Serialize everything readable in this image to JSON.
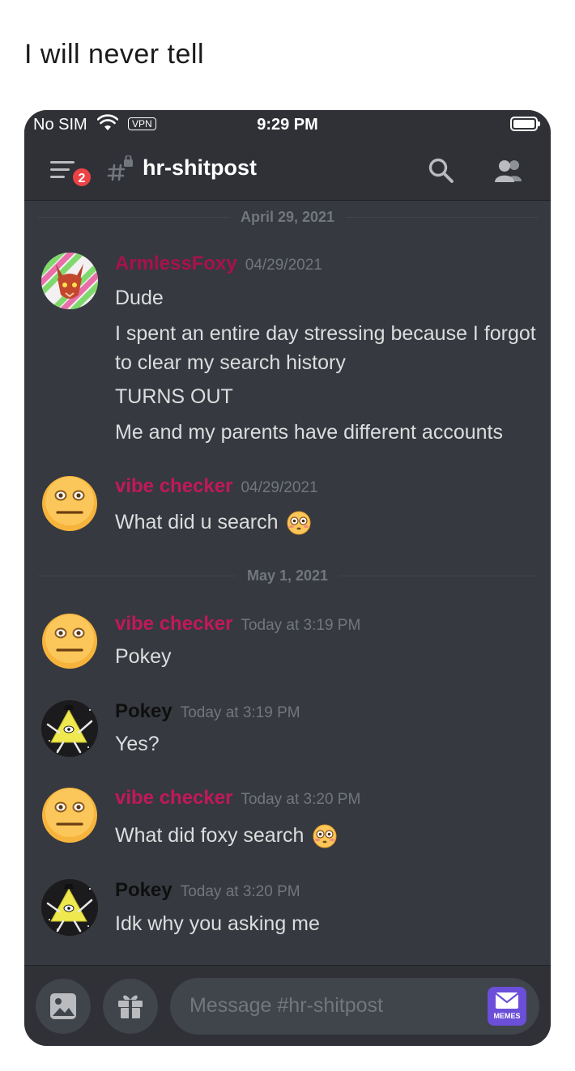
{
  "caption": "I will never tell",
  "status_bar": {
    "carrier": "No SIM",
    "vpn": "VPN",
    "time": "9:29 PM"
  },
  "header": {
    "notification_count": "2",
    "channel_name": "hr-shitpost"
  },
  "date_dividers": [
    "April 29, 2021",
    "May 1, 2021"
  ],
  "messages": [
    {
      "author": "ArmlessFoxy",
      "author_color": "#a8124a",
      "timestamp": "04/29/2021",
      "lines": [
        "Dude",
        "I spent an entire day stressing because I forgot to clear my search history",
        "TURNS OUT",
        "Me and my parents have different accounts"
      ],
      "avatar": "fox-avatar"
    },
    {
      "author": "vibe checker",
      "author_color": "#c2185b",
      "timestamp": "04/29/2021",
      "lines": [
        "What did u search"
      ],
      "emoji": "flushed-face",
      "avatar": "emoji-face-avatar"
    },
    {
      "author": "vibe checker",
      "author_color": "#c2185b",
      "timestamp": "Today at 3:19 PM",
      "lines": [
        "Pokey"
      ],
      "avatar": "emoji-face-avatar"
    },
    {
      "author": "Pokey",
      "author_color": "#0f0f0f",
      "timestamp": "Today at 3:19 PM",
      "lines": [
        "Yes?"
      ],
      "avatar": "triangle-avatar"
    },
    {
      "author": "vibe checker",
      "author_color": "#c2185b",
      "timestamp": "Today at 3:20 PM",
      "lines": [
        "What did foxy search"
      ],
      "emoji": "flushed-face",
      "avatar": "emoji-face-avatar"
    },
    {
      "author": "Pokey",
      "author_color": "#0f0f0f",
      "timestamp": "Today at 3:20 PM",
      "lines": [
        "Idk why you asking me"
      ],
      "avatar": "triangle-avatar"
    }
  ],
  "composer": {
    "placeholder": "Message #hr-shitpost",
    "sticker_label": "MEMES"
  },
  "colors": {
    "background": "#36393f",
    "header": "#2f3136",
    "text": "#dcddde",
    "muted": "#72767d",
    "badge": "#ed4245"
  }
}
